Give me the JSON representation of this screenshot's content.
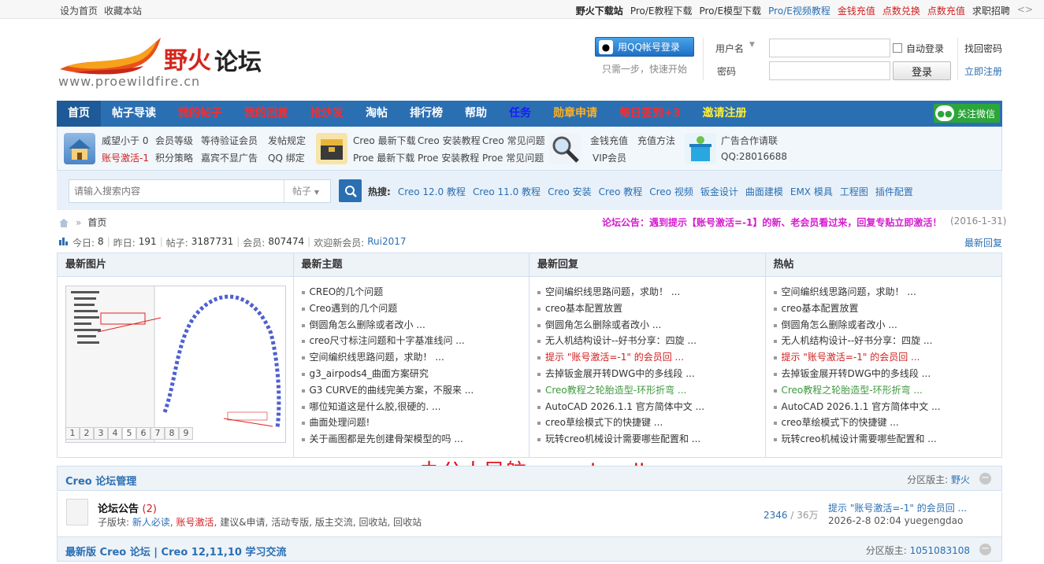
{
  "topbar": {
    "left": [
      "设为首页",
      "收藏本站"
    ],
    "right": [
      {
        "text": "野火下载站",
        "color": "#222",
        "bold": true
      },
      {
        "text": "Pro/E教程下载",
        "color": "#333"
      },
      {
        "text": "Pro/E模型下载",
        "color": "#333"
      },
      {
        "text": "Pro/E视频教程",
        "color": "#2b6fb3"
      },
      {
        "text": "金钱充值",
        "color": "#d01f1f"
      },
      {
        "text": "点数兑换",
        "color": "#d01f1f"
      },
      {
        "text": "点数充值",
        "color": "#d01f1f"
      },
      {
        "text": "求职招聘",
        "color": "#333"
      }
    ],
    "toggle": "<>"
  },
  "logo": {
    "brand": "野火",
    "brand2": "论坛",
    "url": "www.proewildfire.cn"
  },
  "qq_login": {
    "button": "用QQ帐号登录",
    "tip": "只需一步，快速开始"
  },
  "login": {
    "username_label": "用户名",
    "password_label": "密码",
    "auto_login": "自动登录",
    "submit": "登录",
    "forgot": "找回密码",
    "register": "立即注册"
  },
  "nav": {
    "items": [
      {
        "label": "首页",
        "color": "#ffffff",
        "active": true
      },
      {
        "label": "帖子导读",
        "color": "#ffffff"
      },
      {
        "label": "我的帖子",
        "color": "#ff2a2a"
      },
      {
        "label": "我的回复",
        "color": "#ff2a2a"
      },
      {
        "label": "抢沙发",
        "color": "#ff2a2a"
      },
      {
        "label": "淘帖",
        "color": "#ffffff"
      },
      {
        "label": "排行榜",
        "color": "#ffffff"
      },
      {
        "label": "帮助",
        "color": "#ffffff"
      },
      {
        "label": "任务",
        "color": "#1a1aff"
      },
      {
        "label": "勋章申请",
        "color": "#ffb020"
      },
      {
        "label": "每日签到+3",
        "color": "#ff2a2a"
      },
      {
        "label": "邀请注册",
        "color": "#ffee33"
      }
    ],
    "wechat": "关注微信"
  },
  "subnav": {
    "group1": [
      [
        "威望小于 0",
        "会员等级",
        "等待验证会员",
        "发帖规定"
      ],
      [
        "账号激活-1",
        "积分策略",
        "嘉宾不显广告",
        "QQ 绑定"
      ]
    ],
    "group2": [
      [
        "Creo 最新下载",
        "Creo 安装教程",
        "Creo 常见问题"
      ],
      [
        "Proe 最新下载",
        "Proe 安装教程",
        "Proe 常见问题"
      ]
    ],
    "group3": [
      [
        "金钱充值",
        "充值方法"
      ],
      [
        "VIP会员"
      ]
    ],
    "group4": [
      [
        "广告合作请联"
      ],
      [
        "QQ:28016688"
      ]
    ]
  },
  "search": {
    "placeholder": "请输入搜索内容",
    "type": "帖子",
    "hot_label": "热搜:",
    "hot": [
      "Creo 12.0 教程",
      "Creo 11.0 教程",
      "Creo 安装",
      "Creo 教程",
      "Creo 视频",
      "钣金设计",
      "曲面建模",
      "EMX 模具",
      "工程图",
      "插件配置"
    ]
  },
  "breadcrumb": {
    "home": "首页"
  },
  "notice": {
    "text": "论坛公告：遇到提示【账号激活=-1】的新、老会员看过来，回复专贴立即激活！",
    "date": "(2016-1-31)"
  },
  "stats": {
    "today_label": "今日:",
    "today": "8",
    "yesterday_label": "昨日:",
    "yesterday": "191",
    "posts_label": "帖子:",
    "posts": "3187731",
    "members_label": "会员:",
    "members": "807474",
    "welcome_label": "欢迎新会员:",
    "newest": "Rui2017",
    "latest_reply": "最新回复"
  },
  "columns": {
    "pics": {
      "title": "最新图片",
      "pages": [
        "1",
        "2",
        "3",
        "4",
        "5",
        "6",
        "7",
        "8",
        "9"
      ],
      "current_page": 5
    },
    "new_topics": {
      "title": "最新主题",
      "items": [
        {
          "text": "CREO的几个问题"
        },
        {
          "text": "Creo遇到的几个问题"
        },
        {
          "text": "倒圆角怎么删除或者改小 ..."
        },
        {
          "text": "creo尺寸标注问题和十字基准线问 ..."
        },
        {
          "text": "空间编织线思路问题，求助！ ..."
        },
        {
          "text": "g3_airpods4_曲面方案研究"
        },
        {
          "text": "G3 CURVE的曲线完美方案，不服来 ..."
        },
        {
          "text": "哪位知道这是什么胶,很硬的. ..."
        },
        {
          "text": "曲面处理问题!"
        },
        {
          "text": "关于画图都是先创建骨架模型的吗 ..."
        }
      ]
    },
    "new_replies": {
      "title": "最新回复",
      "items": [
        {
          "text": "空间编织线思路问题，求助！ ..."
        },
        {
          "text": "creo基本配置放置"
        },
        {
          "text": "倒圆角怎么删除或者改小 ..."
        },
        {
          "text": "无人机结构设计--好书分享：四旋 ..."
        },
        {
          "text": "提示 \"账号激活=-1\" 的会员回 ...",
          "style": "red"
        },
        {
          "text": "去掉钣金展开转DWG中的多线段 ..."
        },
        {
          "text": "Creo教程之轮胎造型-环形折弯 ...",
          "style": "green"
        },
        {
          "text": "AutoCAD 2026.1.1 官方简体中文 ..."
        },
        {
          "text": "creo草绘模式下的快捷键 ..."
        },
        {
          "text": "玩转creo机械设计需要哪些配置和 ..."
        }
      ]
    },
    "hot": {
      "title": "热帖",
      "items": [
        {
          "text": "空间编织线思路问题，求助！ ..."
        },
        {
          "text": "creo基本配置放置"
        },
        {
          "text": "倒圆角怎么删除或者改小 ..."
        },
        {
          "text": "无人机结构设计--好书分享：四旋 ..."
        },
        {
          "text": "提示 \"账号激活=-1\" 的会员回 ...",
          "style": "red"
        },
        {
          "text": "去掉钣金展开转DWG中的多线段 ..."
        },
        {
          "text": "Creo教程之轮胎造型-环形折弯 ...",
          "style": "green"
        },
        {
          "text": "AutoCAD 2026.1.1 官方简体中文 ..."
        },
        {
          "text": "creo草绘模式下的快捷键 ..."
        },
        {
          "text": "玩转creo机械设计需要哪些配置和 ..."
        }
      ]
    }
  },
  "watermark": "办公人导航  www.bgrdh.com",
  "categories": [
    {
      "title": "Creo 论坛管理",
      "moderator_label": "分区版主:",
      "moderator": "野火"
    },
    {
      "title": "最新版 Creo 论坛 | Creo 12,11,10 学习交流",
      "moderator_label": "分区版主:",
      "moderator": "1051083108"
    }
  ],
  "forum": {
    "name": "论坛公告",
    "count": "(2)",
    "subs_label": "子版块:",
    "subs": [
      {
        "text": "新人必读",
        "color": "#2b6fb3"
      },
      {
        "text": "账号激活",
        "color": "#d01f1f"
      },
      {
        "text": "建议&申请",
        "color": "#555"
      },
      {
        "text": "活动专版",
        "color": "#555"
      },
      {
        "text": "版主交流",
        "color": "#555"
      },
      {
        "text": "回收站",
        "color": "#555"
      },
      {
        "text": "回收站",
        "color": "#555"
      }
    ],
    "threads": "2346",
    "posts": "36万",
    "last_title": "提示 \"账号激活=-1\" 的会员回 ...",
    "last_time": "2026-2-8 02:04 yuegengdao"
  }
}
